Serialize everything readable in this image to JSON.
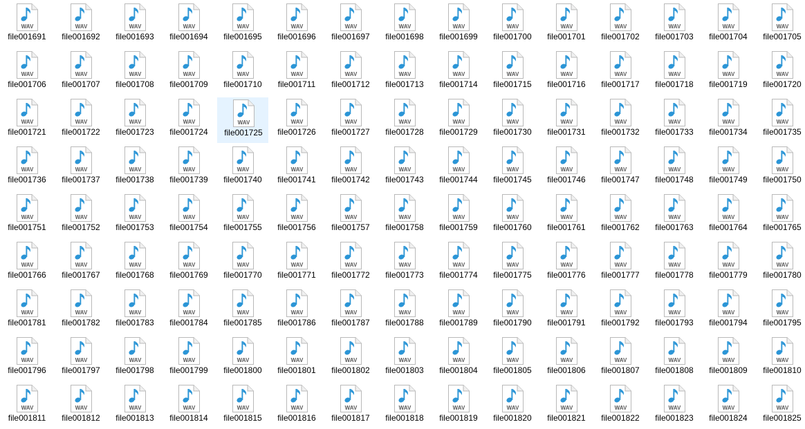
{
  "file_view": {
    "icon": "wav-audio-file-icon",
    "icon_badge": "WAV",
    "columns": 15,
    "selected_file": "file001725",
    "files": [
      "file001691",
      "file001692",
      "file001693",
      "file001694",
      "file001695",
      "file001696",
      "file001697",
      "file001698",
      "file001699",
      "file001700",
      "file001701",
      "file001702",
      "file001703",
      "file001704",
      "file001705",
      "file001706",
      "file001707",
      "file001708",
      "file001709",
      "file001710",
      "file001711",
      "file001712",
      "file001713",
      "file001714",
      "file001715",
      "file001716",
      "file001717",
      "file001718",
      "file001719",
      "file001720",
      "file001721",
      "file001722",
      "file001723",
      "file001724",
      "file001725",
      "file001726",
      "file001727",
      "file001728",
      "file001729",
      "file001730",
      "file001731",
      "file001732",
      "file001733",
      "file001734",
      "file001735",
      "file001736",
      "file001737",
      "file001738",
      "file001739",
      "file001740",
      "file001741",
      "file001742",
      "file001743",
      "file001744",
      "file001745",
      "file001746",
      "file001747",
      "file001748",
      "file001749",
      "file001750",
      "file001751",
      "file001752",
      "file001753",
      "file001754",
      "file001755",
      "file001756",
      "file001757",
      "file001758",
      "file001759",
      "file001760",
      "file001761",
      "file001762",
      "file001763",
      "file001764",
      "file001765",
      "file001766",
      "file001767",
      "file001768",
      "file001769",
      "file001770",
      "file001771",
      "file001772",
      "file001773",
      "file001774",
      "file001775",
      "file001776",
      "file001777",
      "file001778",
      "file001779",
      "file001780",
      "file001781",
      "file001782",
      "file001783",
      "file001784",
      "file001785",
      "file001786",
      "file001787",
      "file001788",
      "file001789",
      "file001790",
      "file001791",
      "file001792",
      "file001793",
      "file001794",
      "file001795",
      "file001796",
      "file001797",
      "file001798",
      "file001799",
      "file001800",
      "file001801",
      "file001802",
      "file001803",
      "file001804",
      "file001805",
      "file001806",
      "file001807",
      "file001808",
      "file001809",
      "file001810",
      "file001811",
      "file001812",
      "file001813",
      "file001814",
      "file001815",
      "file001816",
      "file001817",
      "file001818",
      "file001819",
      "file001820",
      "file001821",
      "file001822",
      "file001823",
      "file001824",
      "file001825"
    ],
    "colors": {
      "selection": "#e5f3ff",
      "note": "#2b95d6",
      "page": "#ffffff",
      "page_border": "#b9b9b9",
      "badge_text": "#5a5a5a"
    }
  }
}
